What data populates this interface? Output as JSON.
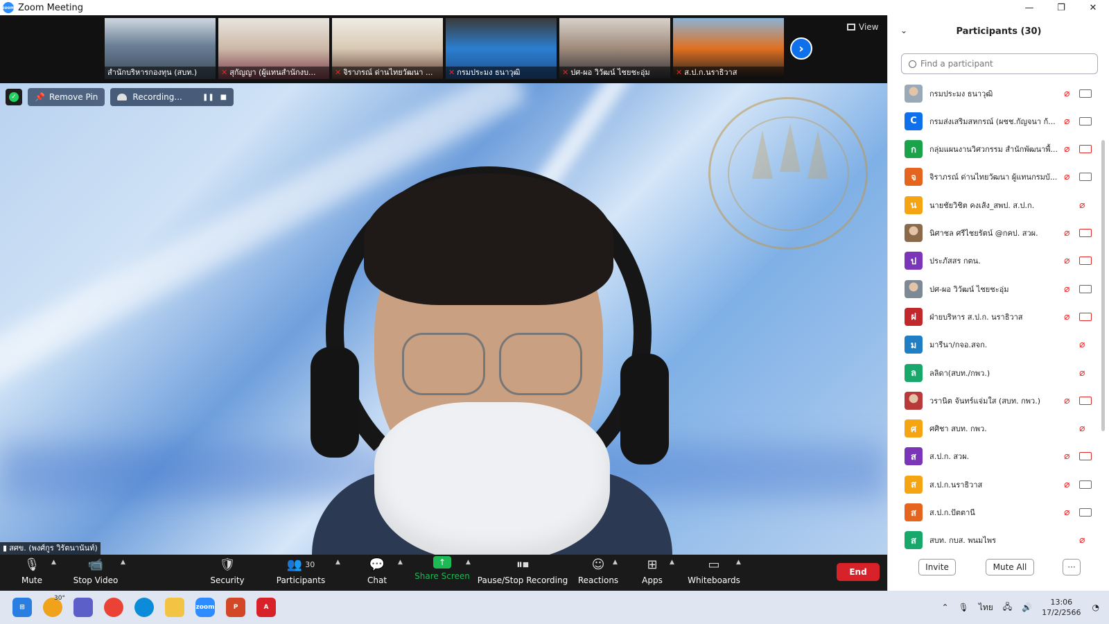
{
  "window": {
    "title": "Zoom Meeting",
    "logo_text": "zoom",
    "minimize": "—",
    "maximize": "❐",
    "close": "✕"
  },
  "gallery": {
    "thumbnails": [
      {
        "caption": "สำนักบริหารกองทุน (สบท.)",
        "muted": false
      },
      {
        "caption": "สุกัญญา (ผู้แทนสำนักงบ...",
        "muted": true
      },
      {
        "caption": "จิราภรณ์ ด่านไทยวัฒนา ...",
        "muted": true
      },
      {
        "caption": "กรมประมง ธนาวุฒิ",
        "muted": true
      },
      {
        "caption": "ปศ-ผอ วิวัฒน์ ไชยชะอุ่ม",
        "muted": true
      },
      {
        "caption": "ส.ป.ก.นราธิวาส",
        "muted": true
      }
    ],
    "view_label": "View"
  },
  "overlay": {
    "remove_pin": "Remove Pin",
    "recording": "Recording...",
    "speaker_name": "สศข. (พงศ์กูร วิรัตนานันท์)"
  },
  "toolbar": {
    "mute": "Mute",
    "stop_video": "Stop Video",
    "security": "Security",
    "participants": "Participants",
    "participants_count": "30",
    "chat": "Chat",
    "share_screen": "Share Screen",
    "pause_stop_recording": "Pause/Stop Recording",
    "reactions": "Reactions",
    "apps": "Apps",
    "whiteboards": "Whiteboards",
    "end": "End"
  },
  "panel": {
    "title": "Participants (30)",
    "search_placeholder": "Find a participant",
    "participants": [
      {
        "name": "กรมประมง ธนาวุฒิ",
        "initial": "",
        "color": "#9aa9b8",
        "photo": true,
        "video": true
      },
      {
        "name": "กรมส่งเสริมสหกรณ์ (ผชช.กัญจนา ก้...",
        "initial": "C",
        "color": "#0e71eb",
        "photo": false,
        "video": true
      },
      {
        "name": "กลุ่มแผนงานวิศวกรรม สำนักพัฒนาพื้...",
        "initial": "ก",
        "color": "#1aa34a",
        "photo": false,
        "video": false
      },
      {
        "name": "จิราภรณ์ ด่านไทยวัฒนา ผู้แทนกรมบั...",
        "initial": "จ",
        "color": "#e5651f",
        "photo": false,
        "video": true
      },
      {
        "name": "นายชัยวิชิต คงเส้ง_สพป. ส.ป.ก.",
        "initial": "น",
        "color": "#f5a511",
        "photo": false,
        "video": null
      },
      {
        "name": "นิศาชล ศรีไชยรัตน์ @กคป. สวผ.",
        "initial": "",
        "color": "#8a6a4a",
        "photo": true,
        "video": false
      },
      {
        "name": "ประภัสสร กตน.",
        "initial": "ป",
        "color": "#7b35b8",
        "photo": false,
        "video": false
      },
      {
        "name": "ปศ-ผอ วิวัฒน์ ไชยชะอุ่ม",
        "initial": "",
        "color": "#7d8a96",
        "photo": true,
        "video": true
      },
      {
        "name": "ฝ่ายบริหาร ส.ป.ก. นราธิวาส",
        "initial": "ฝ",
        "color": "#c0282b",
        "photo": false,
        "video": false
      },
      {
        "name": "มารีนา/กจอ.สจก.",
        "initial": "ม",
        "color": "#1f7ec4",
        "photo": false,
        "video": null
      },
      {
        "name": "ลลิดา(สบท./กพว.)",
        "initial": "ล",
        "color": "#18a86b",
        "photo": false,
        "video": null
      },
      {
        "name": "วรานิต จันทร์แจ่มใส (สบท. กพว.)",
        "initial": "",
        "color": "#b83a3a",
        "photo": true,
        "video": false
      },
      {
        "name": "ศศิชา สบท. กพว.",
        "initial": "ศ",
        "color": "#f5a511",
        "photo": false,
        "video": null
      },
      {
        "name": "ส.ป.ก. สวผ.",
        "initial": "ส",
        "color": "#7b35b8",
        "photo": false,
        "video": false
      },
      {
        "name": "ส.ป.ก.นราธิวาส",
        "initial": "ส",
        "color": "#f5a511",
        "photo": false,
        "video": true
      },
      {
        "name": "ส.ป.ก.ปัตตานี",
        "initial": "ส",
        "color": "#e5651f",
        "photo": false,
        "video": true
      },
      {
        "name": "สบท. กบส. พนมไพร",
        "initial": "ส",
        "color": "#18a86b",
        "photo": false,
        "video": null
      }
    ],
    "invite": "Invite",
    "mute_all": "Mute All",
    "more": "···"
  },
  "taskbar": {
    "weather": "30°",
    "lang": "ไทย",
    "time": "13:06",
    "date": "17/2/2566"
  }
}
